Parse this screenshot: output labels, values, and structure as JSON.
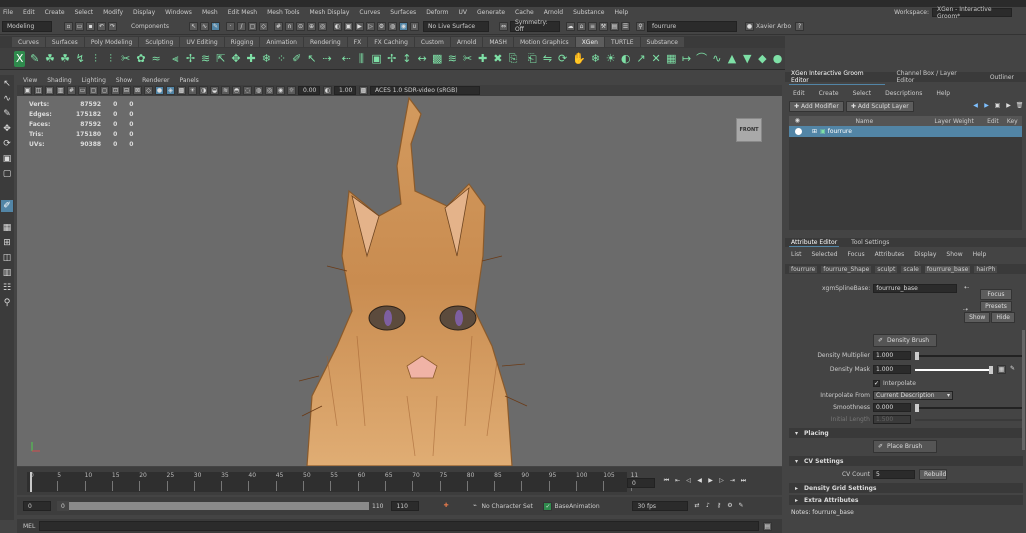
{
  "menubar": {
    "items": [
      "File",
      "Edit",
      "Create",
      "Select",
      "Modify",
      "Display",
      "Windows",
      "Mesh",
      "Edit Mesh",
      "Mesh Tools",
      "Mesh Display",
      "Curves",
      "Surfaces",
      "Deform",
      "UV",
      "Generate",
      "Cache",
      "Arnold",
      "Substance",
      "Help"
    ],
    "workspace_label": "Workspace:",
    "workspace_value": "XGen - Interactive Groom*"
  },
  "statusline": {
    "mode": "Modeling",
    "components": "Components",
    "live_surface": "No Live Surface",
    "symmetry": "Symmetry: Off",
    "search": "fourrure",
    "user": "Xavier Arbo"
  },
  "shelf_tabs": [
    "Curves",
    "Surfaces",
    "Poly Modeling",
    "Sculpting",
    "UV Editing",
    "Rigging",
    "Animation",
    "Rendering",
    "FX",
    "FX Caching",
    "Custom",
    "Arnold",
    "MASH",
    "Motion Graphics",
    "XGen",
    "TURTLE",
    "Substance"
  ],
  "shelf_active": "XGen",
  "shelf_icons": [
    "xgen",
    "brush",
    "leaf",
    "leaf2",
    "curve",
    "comb",
    "comb2",
    "cut",
    "puff",
    "noise",
    "clump",
    "twist",
    "smooth",
    "scale",
    "grab",
    "place",
    "freeze",
    "density",
    "sculpt",
    "select",
    "attract",
    "repel",
    "part",
    "preserve",
    "twist2",
    "length",
    "width",
    "mask",
    "smooth2",
    "cut2",
    "add",
    "delete",
    "copy",
    "paste",
    "flip",
    "rotate",
    "pose",
    "freeze2",
    "unfreeze",
    "invert",
    "grow",
    "clear",
    "bake",
    "extend",
    "bend",
    "kink",
    "tip",
    "base",
    "root",
    "collide"
  ],
  "viewport": {
    "menu": [
      "View",
      "Shading",
      "Lighting",
      "Show",
      "Renderer",
      "Panels"
    ],
    "exposure": "0.00",
    "gamma": "1.00",
    "colorspace": "ACES 1.0 SDR-video (sRGB)",
    "cube_label": "FRONT",
    "hud": [
      {
        "label": "Verts:",
        "a": "87592",
        "b": "0",
        "c": "0"
      },
      {
        "label": "Edges:",
        "a": "175182",
        "b": "0",
        "c": "0"
      },
      {
        "label": "Faces:",
        "a": "87592",
        "b": "0",
        "c": "0"
      },
      {
        "label": "Tris:",
        "a": "175180",
        "b": "0",
        "c": "0"
      },
      {
        "label": "UVs:",
        "a": "90388",
        "b": "0",
        "c": "0"
      }
    ]
  },
  "timeline": {
    "ticks": [
      "0",
      "5",
      "10",
      "15",
      "20",
      "25",
      "30",
      "35",
      "40",
      "45",
      "50",
      "55",
      "60",
      "65",
      "70",
      "75",
      "80",
      "85",
      "90",
      "95",
      "100",
      "105",
      "11"
    ],
    "current_frame": "0",
    "range_start": "0",
    "range_inner_start": "0",
    "range_inner_end": "110",
    "range_end": "110",
    "character_set": "No Character Set",
    "anim_layer": "BaseAnimation",
    "fps": "30 fps"
  },
  "mel": {
    "label": "MEL"
  },
  "right_panel": {
    "tabs": [
      "XGen Interactive Groom Editor",
      "Channel Box / Layer Editor",
      "Outliner"
    ],
    "menu": [
      "Edit",
      "Create",
      "Select",
      "Descriptions",
      "Help"
    ],
    "add_modifier": "Add Modifier",
    "add_sculpt_layer": "Add Sculpt Layer",
    "cols": [
      "Name",
      "Layer Weight",
      "Edit",
      "Key"
    ],
    "row_name": "fourrure",
    "ae_tabs": [
      "Attribute Editor",
      "Tool Settings"
    ],
    "ae_menu": [
      "List",
      "Selected",
      "Focus",
      "Attributes",
      "Display",
      "Show",
      "Help"
    ],
    "node_tabs": [
      "fourrure",
      "fourrure_Shape",
      "sculpt",
      "scale",
      "fourrure_base",
      "hairPh"
    ],
    "spline_label": "xgmSplineBase:",
    "spline_value": "fourrure_base",
    "focus": "Focus",
    "presets": "Presets",
    "show": "Show",
    "hide": "Hide",
    "density_brush": "Density Brush",
    "density_multiplier_label": "Density Multiplier",
    "density_multiplier": "1.000",
    "density_mask_label": "Density Mask",
    "density_mask": "1.000",
    "interpolate": "Interpolate",
    "interp_from_label": "Interpolate From",
    "interp_from": "Current Description",
    "smoothness_label": "Smoothness",
    "smoothness": "0.000",
    "initial_length_label": "Initial Length",
    "initial_length": "1.500",
    "placing": "Placing",
    "place_brush": "Place Brush",
    "cv_settings": "CV Settings",
    "cv_count_label": "CV Count",
    "cv_count": "5",
    "rebuild": "Rebuild",
    "density_grid": "Density Grid Settings",
    "extra_attributes": "Extra Attributes",
    "notes": "Notes:  fourrure_base"
  }
}
